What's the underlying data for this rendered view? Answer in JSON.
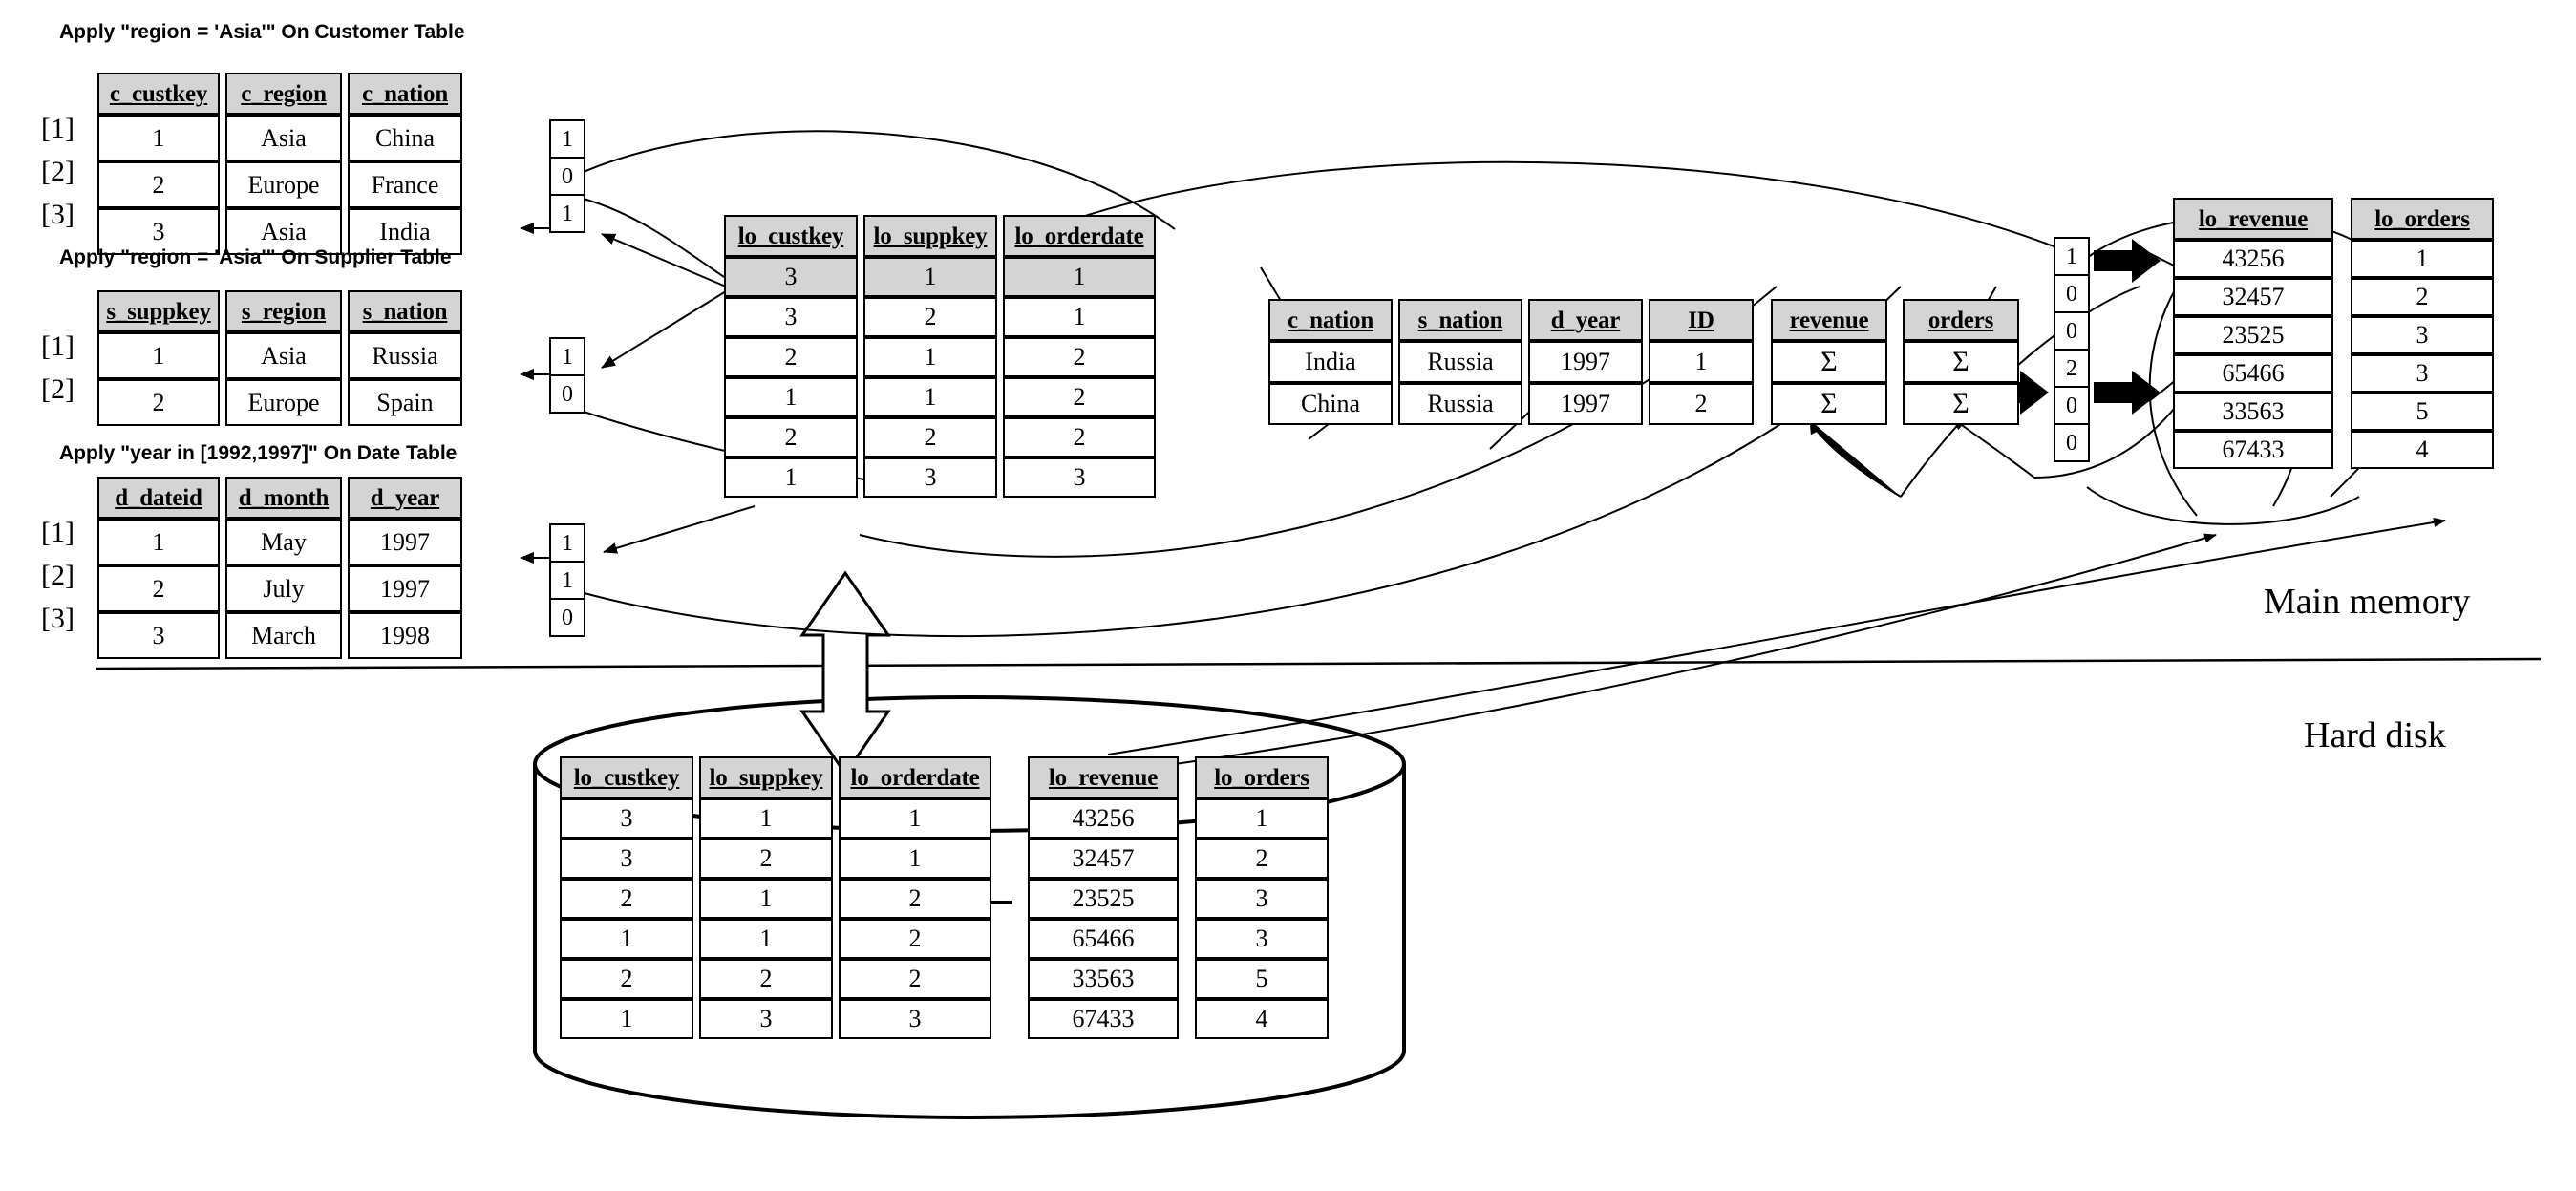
{
  "regions": {
    "main_memory_label": "Main memory",
    "hard_disk_label": "Hard disk"
  },
  "row_index_labels": [
    "[1]",
    "[2]",
    "[3]"
  ],
  "customer": {
    "caption": "Apply \"region = 'Asia'\" On Customer Table",
    "headers": [
      "c_custkey",
      "c_region",
      "c_nation"
    ],
    "rows": [
      [
        "1",
        "Asia",
        "China"
      ],
      [
        "2",
        "Europe",
        "France"
      ],
      [
        "3",
        "Asia",
        "India"
      ]
    ],
    "bitmap": [
      "1",
      "0",
      "1"
    ]
  },
  "supplier": {
    "caption": "Apply \"region = 'Asia'\" On Supplier Table",
    "headers": [
      "s_suppkey",
      "s_region",
      "s_nation"
    ],
    "rows": [
      [
        "1",
        "Asia",
        "Russia"
      ],
      [
        "2",
        "Europe",
        "Spain"
      ]
    ],
    "bitmap": [
      "1",
      "0"
    ]
  },
  "date": {
    "caption": "Apply \"year in [1992,1997]\" On Date Table",
    "headers": [
      "d_dateid",
      "d_month",
      "d_year"
    ],
    "rows": [
      [
        "1",
        "May",
        "1997"
      ],
      [
        "2",
        "July",
        "1997"
      ],
      [
        "3",
        "March",
        "1998"
      ]
    ],
    "bitmap": [
      "1",
      "1",
      "0"
    ]
  },
  "fact_memory": {
    "headers": [
      "lo_custkey",
      "lo_suppkey",
      "lo_orderdate"
    ],
    "rows": [
      [
        "3",
        "1",
        "1"
      ],
      [
        "3",
        "2",
        "1"
      ],
      [
        "2",
        "1",
        "2"
      ],
      [
        "1",
        "1",
        "2"
      ],
      [
        "2",
        "2",
        "2"
      ],
      [
        "1",
        "3",
        "3"
      ]
    ],
    "highlight_row_index": 0
  },
  "group_table": {
    "headers": [
      "c_nation",
      "s_nation",
      "d_year",
      "ID"
    ],
    "rows": [
      [
        "India",
        "Russia",
        "1997",
        "1"
      ],
      [
        "China",
        "Russia",
        "1997",
        "2"
      ]
    ]
  },
  "aggregates": {
    "revenue_header": "revenue",
    "orders_header": "orders",
    "sigma": "Σ",
    "revenue_values": [
      "Σ",
      "Σ"
    ],
    "orders_values": [
      "Σ",
      "Σ"
    ]
  },
  "group_id_bitmap": [
    "1",
    "0",
    "0",
    "2",
    "0",
    "0"
  ],
  "columns_memory": {
    "revenue_header": "lo_revenue",
    "orders_header": "lo_orders",
    "revenue_values": [
      "43256",
      "32457",
      "23525",
      "65466",
      "33563",
      "67433"
    ],
    "orders_values": [
      "1",
      "2",
      "3",
      "3",
      "5",
      "4"
    ]
  },
  "disk_fact": {
    "headers": [
      "lo_custkey",
      "lo_suppkey",
      "lo_orderdate"
    ],
    "rows": [
      [
        "3",
        "1",
        "1"
      ],
      [
        "3",
        "2",
        "1"
      ],
      [
        "2",
        "1",
        "2"
      ],
      [
        "1",
        "1",
        "2"
      ],
      [
        "2",
        "2",
        "2"
      ],
      [
        "1",
        "3",
        "3"
      ]
    ]
  },
  "disk_columns": {
    "revenue_header": "lo_revenue",
    "orders_header": "lo_orders",
    "revenue_values": [
      "43256",
      "32457",
      "23525",
      "65466",
      "33563",
      "67433"
    ],
    "orders_values": [
      "1",
      "2",
      "3",
      "3",
      "5",
      "4"
    ]
  },
  "colors": {
    "header_fill": "#d4d4d4",
    "stroke": "#000000",
    "background": "#ffffff"
  }
}
